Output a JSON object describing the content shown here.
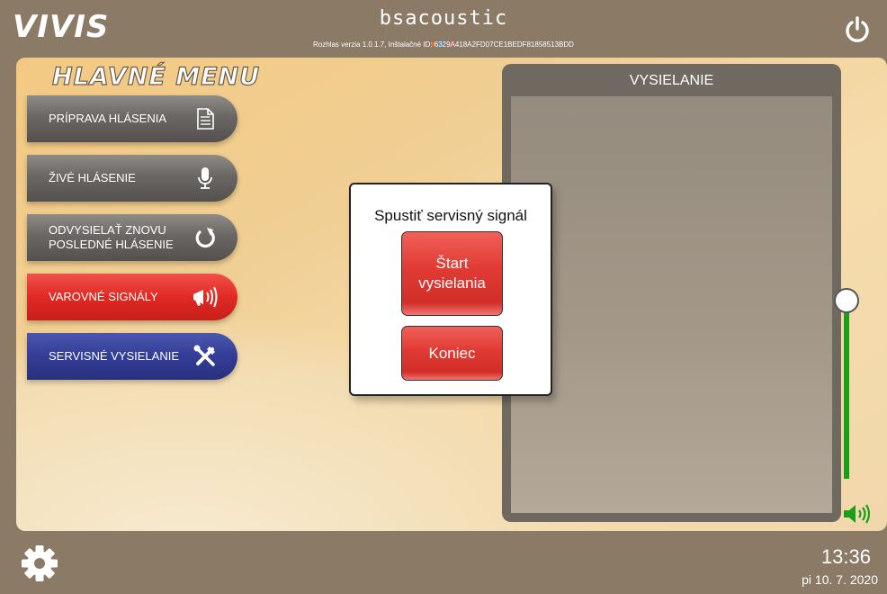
{
  "header": {
    "brand": "VIVIS",
    "partner_brand": "bsacoustic",
    "version_text": "Rozhlas verzia 1.0.1.7, Inštalačné ID: 6329A418A2FD07CE1BEDF81858513BDD",
    "power_icon": "power-icon",
    "dot_colors": [
      "#f07020",
      "#3a8fe0",
      "#7a6a9a",
      "#e04040"
    ]
  },
  "menu": {
    "title": "HLAVNÉ MENU",
    "items": [
      {
        "label": "PRÍPRAVA HLÁSENIA",
        "icon": "document-icon",
        "style": "grey"
      },
      {
        "label": "ŽIVÉ HLÁSENIE",
        "icon": "microphone-icon",
        "style": "grey"
      },
      {
        "label": "ODVYSIELAŤ ZNOVU POSLEDNÉ HLÁSENIE",
        "icon": "replay-icon",
        "style": "grey"
      },
      {
        "label": "VAROVNÉ SIGNÁLY",
        "icon": "megaphone-icon",
        "style": "red"
      },
      {
        "label": "SERVISNÉ VYSIELANIE",
        "icon": "tools-icon",
        "style": "blue"
      }
    ]
  },
  "broadcast": {
    "title": "VYSIELANIE"
  },
  "modal": {
    "title": "Spustiť servisný signál",
    "start_label": "Štart vysielania",
    "end_label": "Koniec"
  },
  "volume": {
    "level": 1.0,
    "icon": "speaker-icon"
  },
  "footer": {
    "settings_icon": "gear-icon",
    "time": "13:36",
    "date": "pi 10. 7. 2020"
  },
  "colors": {
    "accent_red": "#e02a24",
    "accent_blue": "#333d96",
    "volume_green": "#19a019",
    "frame": "#8a7a66"
  }
}
